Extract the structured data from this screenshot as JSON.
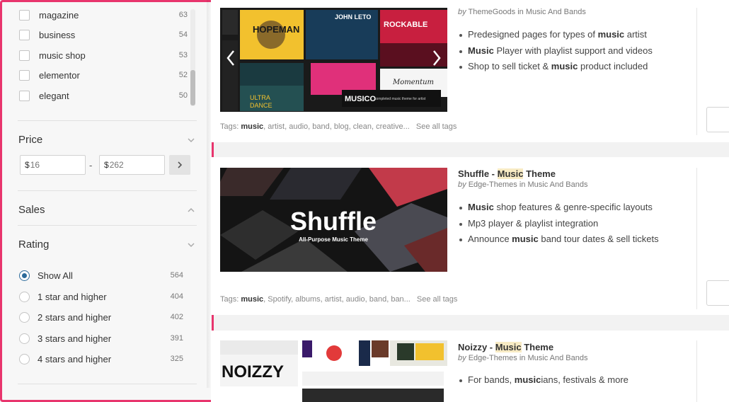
{
  "categories": [
    {
      "label": "magazine",
      "count": "63"
    },
    {
      "label": "business",
      "count": "54"
    },
    {
      "label": "music shop",
      "count": "53"
    },
    {
      "label": "elementor",
      "count": "52"
    },
    {
      "label": "elegant",
      "count": "50"
    }
  ],
  "price": {
    "title": "Price",
    "currency": "$",
    "min_placeholder": "16",
    "max_placeholder": "262",
    "separator": "-"
  },
  "sales": {
    "title": "Sales"
  },
  "rating": {
    "title": "Rating",
    "options": [
      {
        "label": "Show All",
        "count": "564",
        "selected": true
      },
      {
        "label": "1 star and higher",
        "count": "404"
      },
      {
        "label": "2 stars and higher",
        "count": "402"
      },
      {
        "label": "3 stars and higher",
        "count": "391"
      },
      {
        "label": "4 stars and higher",
        "count": "325"
      }
    ]
  },
  "results": [
    {
      "author": "ThemeGoods",
      "category": "Music And Bands",
      "by": "by",
      "in": "in",
      "thumb_texts": [
        "JOHN LETO",
        "HOPEMAN",
        "ROCKABLE",
        "ULTRA",
        "DANCE",
        "Momentum",
        "MUSICO",
        "completed music theme for artist"
      ],
      "features": [
        {
          "pre": "Predesigned pages for types of ",
          "bold": "music",
          "post": " artist"
        },
        {
          "pre": "",
          "bold": "Music",
          "post": " Player with playlist support and videos"
        },
        {
          "pre": "Shop to sell ticket & ",
          "bold": "music",
          "post": " product included"
        }
      ],
      "tags_prefix": "Tags:",
      "tags_bold": "music",
      "tags_rest": ", artist, audio, band, blog, clean, creative...",
      "see_all": "See all tags"
    },
    {
      "title_pre": "Shuffle - ",
      "title_mark": "Music",
      "title_post": " Theme",
      "author": "Edge-Themes",
      "category": "Music And Bands",
      "by": "by",
      "in": "in",
      "thumb_title": "Shuffle",
      "thumb_sub": "All-Purpose Music Theme",
      "features": [
        {
          "pre": "",
          "bold": "Music",
          "post": " shop features & genre-specific layouts"
        },
        {
          "pre": "Mp3 player & playlist integration",
          "bold": "",
          "post": ""
        },
        {
          "pre": "Announce ",
          "bold": "music",
          "post": " band tour dates & sell tickets"
        }
      ],
      "tags_prefix": "Tags:",
      "tags_bold": "music",
      "tags_rest": ", Spotify, albums, artist, audio, band, ban...",
      "see_all": "See all tags"
    },
    {
      "title_pre": "Noizzy - ",
      "title_mark": "Music",
      "title_post": " Theme",
      "author": "Edge-Themes",
      "category": "Music And Bands",
      "by": "by",
      "in": "in",
      "thumb_title": "NOIZZY",
      "features": [
        {
          "pre": "For bands, ",
          "bold": "music",
          "post": "ians, festivals & more"
        }
      ]
    }
  ],
  "colors": {
    "highlight_border": "#e8356d",
    "title_mark_bg": "#f8ebc4",
    "radio_accent": "#2b6a9a"
  }
}
